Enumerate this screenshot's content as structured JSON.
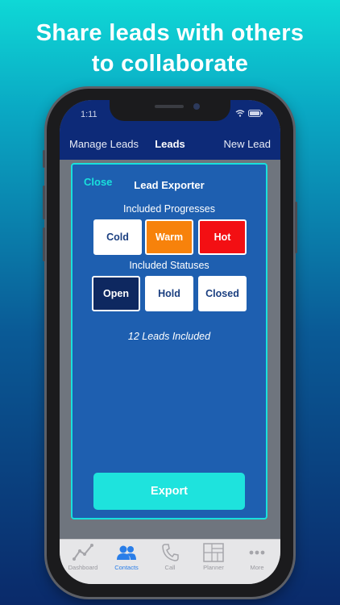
{
  "headline": {
    "line1": "Share leads with others",
    "line2": "to collaborate"
  },
  "status_bar": {
    "time": "1:11"
  },
  "nav": {
    "left": "Manage Leads",
    "title": "Leads",
    "right": "New Lead"
  },
  "modal": {
    "close": "Close",
    "title": "Lead Exporter",
    "progresses_label": "Included Progresses",
    "progresses": [
      {
        "label": "Cold",
        "color": "#ffffff"
      },
      {
        "label": "Warm",
        "color": "#f7820b"
      },
      {
        "label": "Hot",
        "color": "#f30f13"
      }
    ],
    "statuses_label": "Included Statuses",
    "statuses": [
      {
        "label": "Open",
        "selected": true
      },
      {
        "label": "Hold",
        "selected": false
      },
      {
        "label": "Closed",
        "selected": false
      }
    ],
    "summary": "12 Leads Included",
    "export": "Export"
  },
  "tabbar": {
    "items": [
      {
        "label": "Dashboard",
        "icon": "chart-line-icon",
        "active": false
      },
      {
        "label": "Contacts",
        "icon": "people-icon",
        "active": true
      },
      {
        "label": "Call",
        "icon": "phone-icon",
        "active": false
      },
      {
        "label": "Planner",
        "icon": "grid-icon",
        "active": false
      },
      {
        "label": "More",
        "icon": "more-dots-icon",
        "active": false
      }
    ]
  },
  "colors": {
    "accent": "#19e0dc",
    "nav_bg": "#0d2a78",
    "modal_bg": "#1e5fb0",
    "active_tab": "#2a7ee8"
  }
}
